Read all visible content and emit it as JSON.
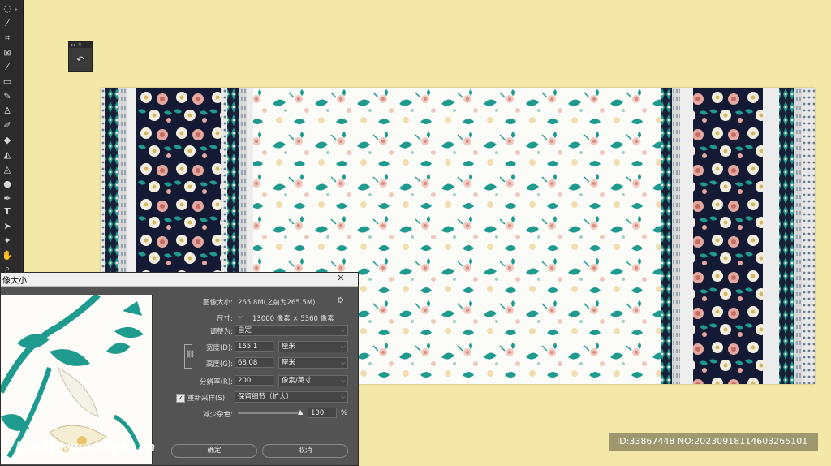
{
  "toolbar": {
    "tools": [
      "lasso-icon",
      "quick-select-icon",
      "crop-icon",
      "frame-icon",
      "eyedropper-icon",
      "healing-icon",
      "brush-icon",
      "stamp-icon",
      "history-brush-icon",
      "eraser-icon",
      "gradient-icon",
      "blur-icon",
      "dodge-icon",
      "pen-icon",
      "type-icon",
      "path-select-icon",
      "shape-icon",
      "hand-icon",
      "zoom-icon"
    ],
    "type_glyph": "T"
  },
  "dialog": {
    "title": "像大小",
    "image_size_label": "图像大小:",
    "image_size_value": "265.8M(之前为265.5M)",
    "dimensions_label": "尺寸:",
    "dimensions_value": "13000 像素 × 5360 像素",
    "fit_label": "调整为:",
    "fit_value": "自定",
    "width_label": "宽度(D):",
    "width_value": "165.1",
    "width_unit": "厘米",
    "height_label": "高度(G):",
    "height_value": "68.08",
    "height_unit": "厘米",
    "resolution_label": "分辨率(R):",
    "resolution_value": "200",
    "resolution_unit": "像素/英寸",
    "resample_label": "重新采样(S):",
    "resample_value": "保留细节（扩大）",
    "noise_label": "减少杂色:",
    "noise_value": "100",
    "noise_unit": "%",
    "ok_label": "确定",
    "cancel_label": "取消"
  },
  "watermark": "昵享网 www.nipic.cn",
  "id_badge": "ID:33867448 NO:20230918114603265101",
  "colors": {
    "background": "#f4e8a8",
    "teal": "#1f9a8e",
    "navy": "#141a33",
    "pink": "#e4a8a0"
  }
}
